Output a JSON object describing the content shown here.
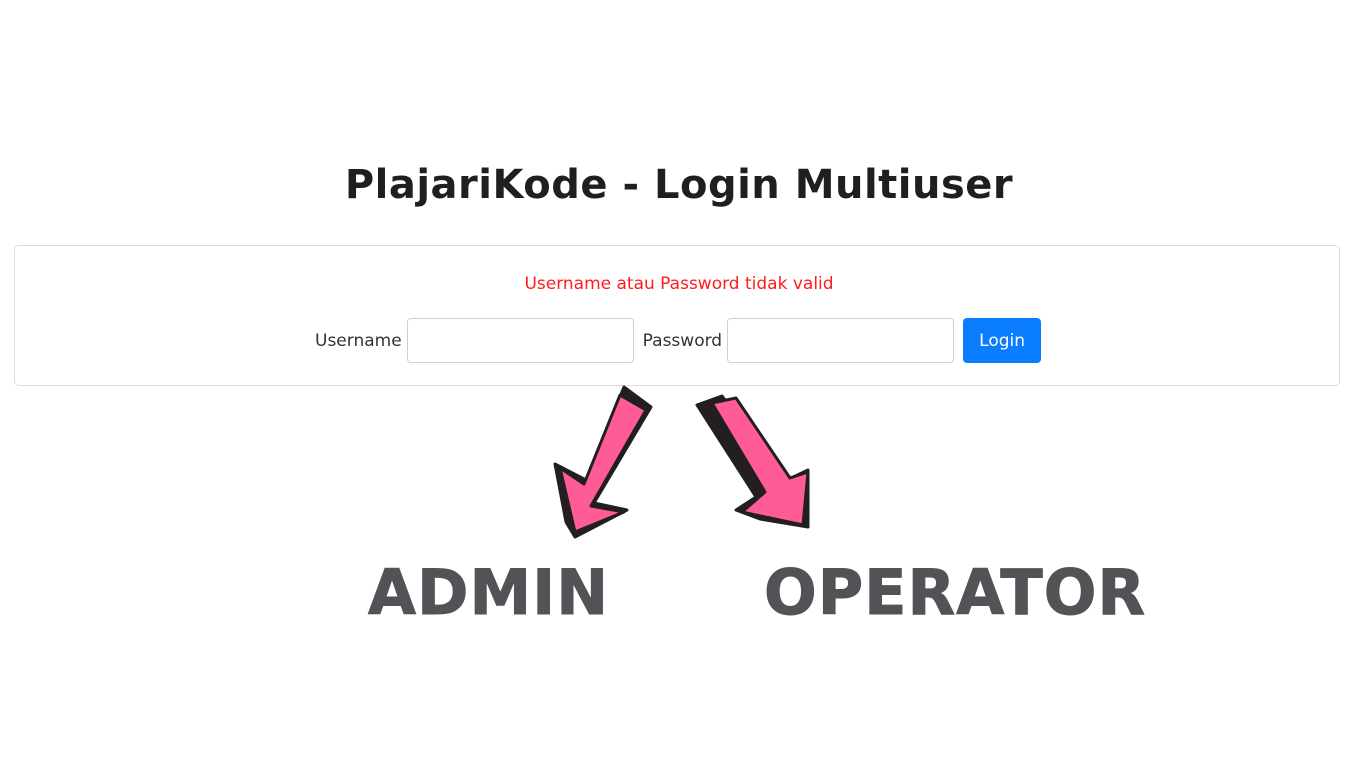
{
  "page": {
    "title": "PlajariKode - Login Multiuser"
  },
  "login_form": {
    "error_message": "Username atau Password tidak valid",
    "username_label": "Username",
    "username_value": "",
    "password_label": "Password",
    "password_value": "",
    "login_button_label": "Login"
  },
  "roles": {
    "admin_label": "ADMIN",
    "operator_label": "OPERATOR"
  },
  "colors": {
    "error_text": "#ff1c1c",
    "button_primary": "#0a7cff",
    "arrow_fill": "#ff5c97",
    "arrow_shadow": "#231f20",
    "role_text": "#535357"
  },
  "icons": {
    "left_arrow": "arrow-down-left-icon",
    "right_arrow": "arrow-down-right-icon"
  }
}
